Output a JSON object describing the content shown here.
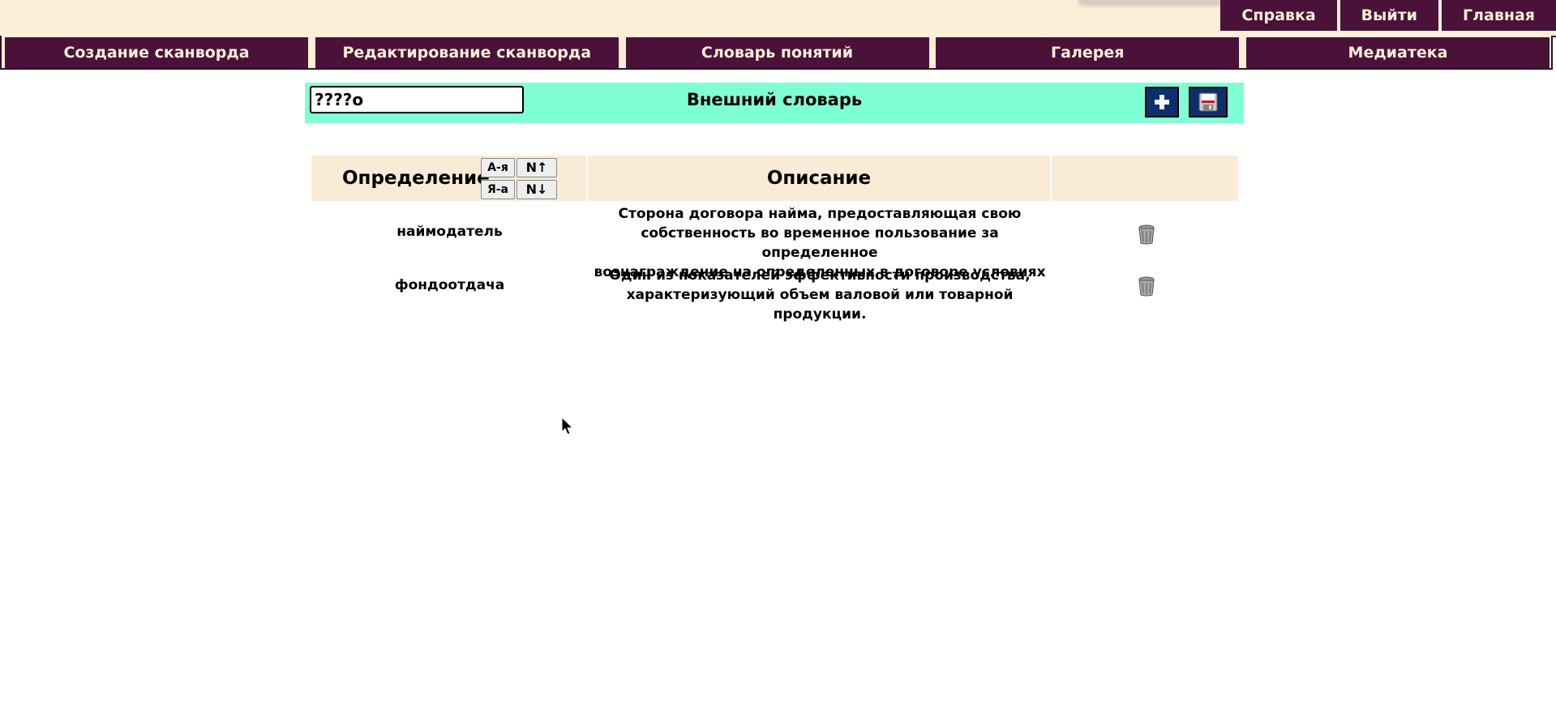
{
  "top_links": [
    "Справка",
    "Выйти",
    "Главная"
  ],
  "nav": [
    "Создание сканворда",
    "Редактирование сканворда",
    "Словарь понятий",
    "Галерея",
    "Медиатека"
  ],
  "dictionary": {
    "title": "Внешний словарь",
    "search_value": "????о",
    "add_icon": "plus-icon",
    "save_icon": "floppy-disk-icon"
  },
  "table": {
    "col_definition": "Определение",
    "col_description": "Описание",
    "sort_buttons": {
      "az": "А-я",
      "za": "Я-а",
      "n_up": "N↑",
      "n_down": "N↓"
    },
    "rows": [
      {
        "term": "наймодатель",
        "desc_lines": [
          "Сторона договора найма, предоставляющая свою",
          "собственность во временное пользование за определенное",
          "вознаграждение на определенных в договоре условиях"
        ]
      },
      {
        "term": "фондоотдача",
        "desc_lines": [
          "Один из показателей эффективности производства,",
          "характеризующий объем валовой или товарной продукции."
        ]
      }
    ],
    "delete_icon": "trash-icon"
  }
}
